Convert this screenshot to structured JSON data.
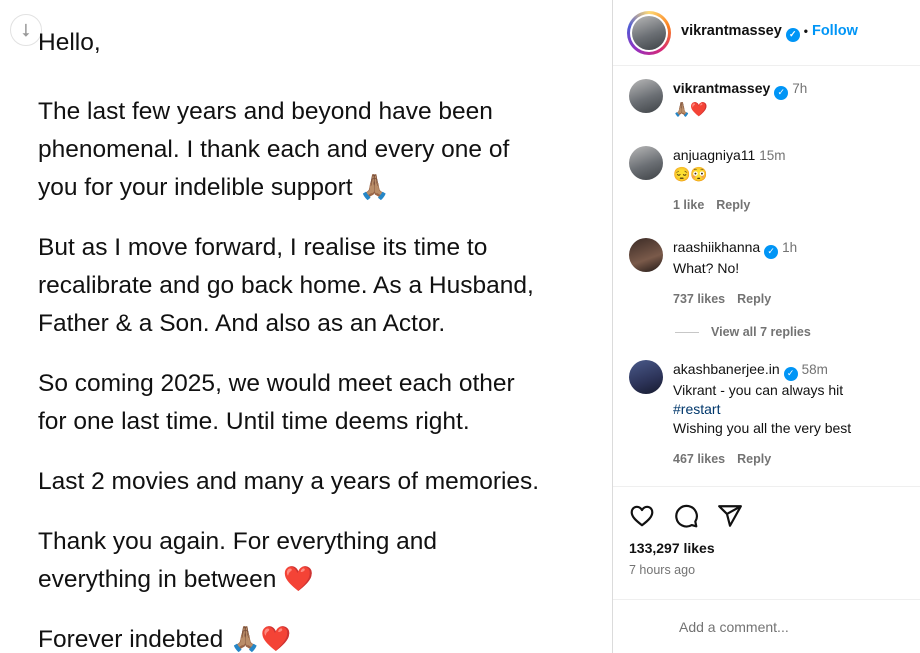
{
  "post": {
    "paragraphs": [
      "Hello,",
      "The last few years and beyond have been\nphenomenal. I thank each and every one of\nyou for your indelible support 🙏🏽",
      "But as I move forward, I realise its time to\nrecalibrate and go back home. As a Husband,\nFather & a Son. And also as an Actor.",
      "So coming 2025, we would meet each other\nfor one last time. Until time deems right.",
      "Last 2 movies and many a years of memories.",
      "Thank you again. For everything and\neverything in between ❤️",
      "Forever indebted 🙏🏽❤️"
    ],
    "download_icon": "download-arrow-icon"
  },
  "header": {
    "username": "vikrantmassey",
    "separator": "•",
    "follow_label": "Follow"
  },
  "comments": [
    {
      "username": "vikrantmassey",
      "verified": true,
      "time": "7h",
      "text": "🙏🏽❤️"
    },
    {
      "username": "anjuagniya11",
      "verified": false,
      "time": "15m",
      "text": "😔😳",
      "likes": "1 like",
      "reply": "Reply"
    },
    {
      "username": "raashiikhanna",
      "verified": true,
      "time": "1h",
      "text": "What? No!",
      "likes": "737 likes",
      "reply": "Reply"
    },
    {
      "username": "akashbanerjee.in",
      "verified": true,
      "time": "58m",
      "text_line1": "Vikrant - you can always hit",
      "hashtag": "#restart",
      "text_line3": "Wishing you all the very best",
      "likes": "467 likes",
      "reply": "Reply"
    }
  ],
  "view_replies": "View all 7 replies",
  "actions": {
    "like_icon": "heart-icon",
    "comment_icon": "comment-icon",
    "share_icon": "share-icon"
  },
  "likes_count": "133,297 likes",
  "posted": "7 hours ago",
  "add_comment_placeholder": "Add a comment...",
  "colors": {
    "accent": "#0095f6",
    "muted": "#737373",
    "hashtag": "#00376b",
    "border": "#efefef"
  }
}
